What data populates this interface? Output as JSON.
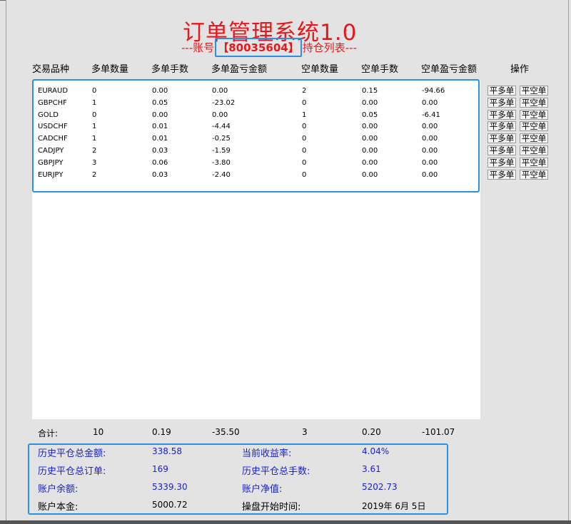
{
  "title": "订单管理系统1.0",
  "subtitle": {
    "prefix": "---账号",
    "account": "【80035604】",
    "suffix": "持仓列表---"
  },
  "columns": [
    "交易品种",
    "多单数量",
    "多单手数",
    "多单盈亏金额",
    "空单数量",
    "空单手数",
    "空单盈亏金额",
    "操作"
  ],
  "rows": [
    {
      "symbol": "EURAUD",
      "buy_count": "0",
      "buy_lots": "0.00",
      "buy_pl": "0.00",
      "sell_count": "2",
      "sell_lots": "0.15",
      "sell_pl": "-94.66"
    },
    {
      "symbol": "GBPCHF",
      "buy_count": "1",
      "buy_lots": "0.05",
      "buy_pl": "-23.02",
      "sell_count": "0",
      "sell_lots": "0.00",
      "sell_pl": "0.00"
    },
    {
      "symbol": "GOLD",
      "buy_count": "0",
      "buy_lots": "0.00",
      "buy_pl": "0.00",
      "sell_count": "1",
      "sell_lots": "0.05",
      "sell_pl": "-6.41"
    },
    {
      "symbol": "USDCHF",
      "buy_count": "1",
      "buy_lots": "0.01",
      "buy_pl": "-4.44",
      "sell_count": "0",
      "sell_lots": "0.00",
      "sell_pl": "0.00"
    },
    {
      "symbol": "CADCHF",
      "buy_count": "1",
      "buy_lots": "0.01",
      "buy_pl": "-0.25",
      "sell_count": "0",
      "sell_lots": "0.00",
      "sell_pl": "0.00"
    },
    {
      "symbol": "CADJPY",
      "buy_count": "2",
      "buy_lots": "0.03",
      "buy_pl": "-1.59",
      "sell_count": "0",
      "sell_lots": "0.00",
      "sell_pl": "0.00"
    },
    {
      "symbol": "GBPJPY",
      "buy_count": "3",
      "buy_lots": "0.06",
      "buy_pl": "-3.80",
      "sell_count": "0",
      "sell_lots": "0.00",
      "sell_pl": "0.00"
    },
    {
      "symbol": "EURJPY",
      "buy_count": "2",
      "buy_lots": "0.03",
      "buy_pl": "-2.40",
      "sell_count": "0",
      "sell_lots": "0.00",
      "sell_pl": "0.00"
    }
  ],
  "buttons": {
    "close_buy": "平多单",
    "close_sell": "平空单"
  },
  "totals": {
    "label": "合计:",
    "buy_count": "10",
    "buy_lots": "0.19",
    "buy_pl": "-35.50",
    "sell_count": "3",
    "sell_lots": "0.20",
    "sell_pl": "-101.07"
  },
  "summary": {
    "hist_close_amount_label": "历史平仓总金额:",
    "hist_close_amount": "338.58",
    "current_yield_label": "当前收益率:",
    "current_yield": "4.04%",
    "hist_close_orders_label": "历史平仓总订单:",
    "hist_close_orders": "169",
    "hist_close_lots_label": "历史平仓总手数:",
    "hist_close_lots": "3.61",
    "balance_label": "账户余额:",
    "balance": "5339.30",
    "equity_label": "账户净值:",
    "equity": "5202.73",
    "principal_label": "账户本金:",
    "principal": "5000.72",
    "start_time_label": "操盘开始时间:",
    "start_time": "2019年 6月 5日"
  },
  "colors": {
    "title": "#e8171b",
    "box_border": "#2d8fe0",
    "summary_value": "#1a22c8"
  }
}
